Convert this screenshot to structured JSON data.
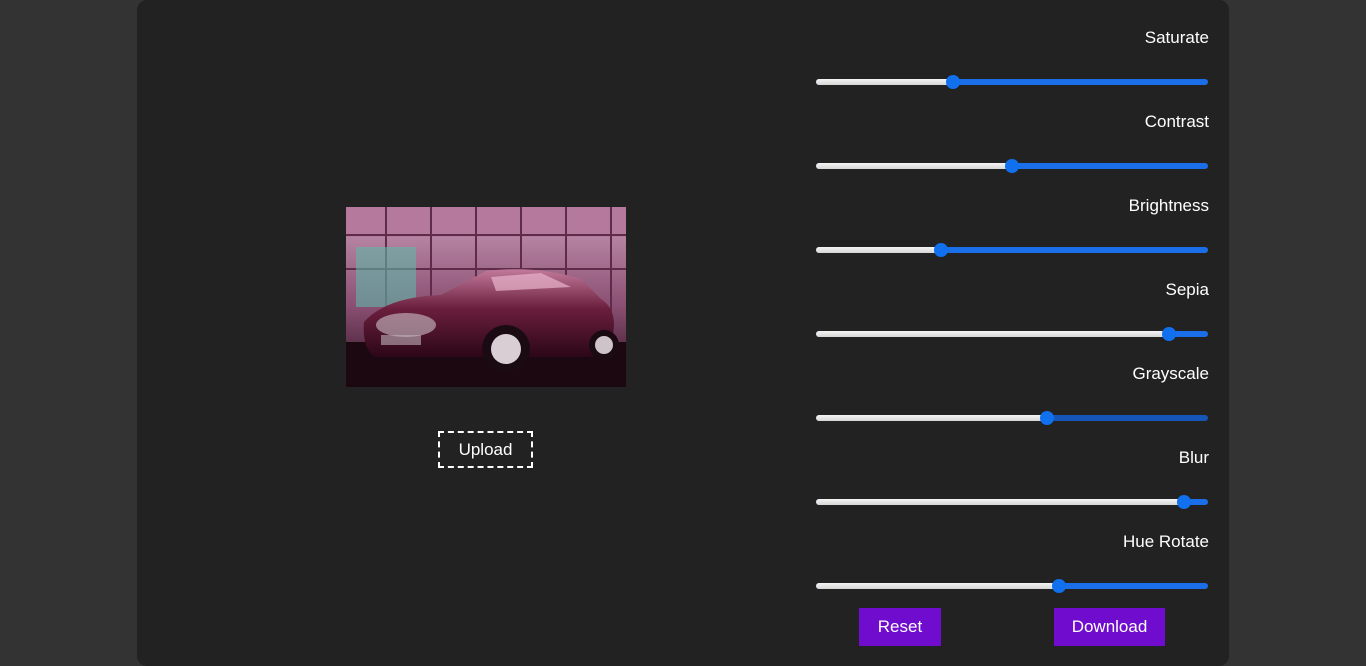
{
  "editor": {
    "upload_label": "Upload",
    "reset_label": "Reset",
    "download_label": "Download",
    "accent_color": "#6f0ccd",
    "slider_color": "#1070ee"
  },
  "filters": [
    {
      "label": "Saturate",
      "value_fraction": 0.35
    },
    {
      "label": "Contrast",
      "value_fraction": 0.5
    },
    {
      "label": "Brightness",
      "value_fraction": 0.32
    },
    {
      "label": "Sepia",
      "value_fraction": 0.9
    },
    {
      "label": "Grayscale",
      "value_fraction": 0.59
    },
    {
      "label": "Blur",
      "value_fraction": 0.94
    },
    {
      "label": "Hue Rotate",
      "value_fraction": 0.62
    }
  ]
}
